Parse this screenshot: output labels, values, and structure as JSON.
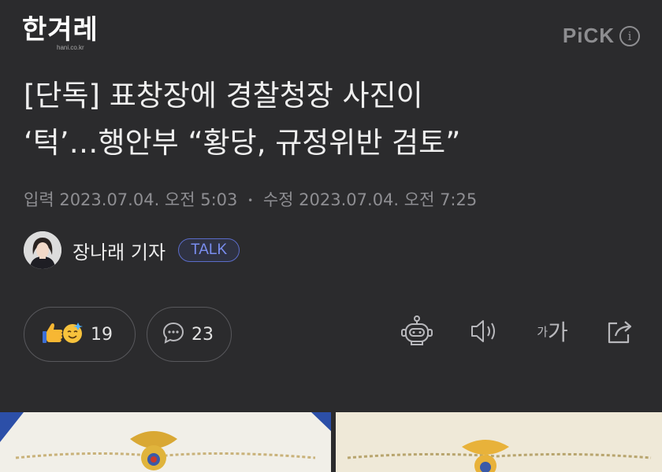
{
  "header": {
    "logo_text": "한겨레",
    "logo_sub": "hani.co.kr",
    "pick_label": "PiCK",
    "info_symbol": "i"
  },
  "article": {
    "headline_line1": "[단독] 표창장에 경찰청장 사진이",
    "headline_line2": "‘턱’…행안부 “황당, 규정위반 검토”",
    "dateline": {
      "input_label": "입력",
      "input_time": "2023.07.04. 오전 5:03",
      "separator": "•",
      "edit_label": "수정",
      "edit_time": "2023.07.04. 오전 7:25"
    },
    "reporter_name": "장나래 기자",
    "talk_label": "TALK"
  },
  "reactions": {
    "count": "19",
    "comment_count": "23"
  },
  "tools": [
    "robot-summary-icon",
    "speaker-icon",
    "font-size-icon",
    "share-icon"
  ],
  "font_size_label": {
    "small": "가",
    "large": "가"
  },
  "colors": {
    "background": "#2b2b2d",
    "talk_accent": "#7a8ef0",
    "badge_gold": "#e8b23a"
  }
}
